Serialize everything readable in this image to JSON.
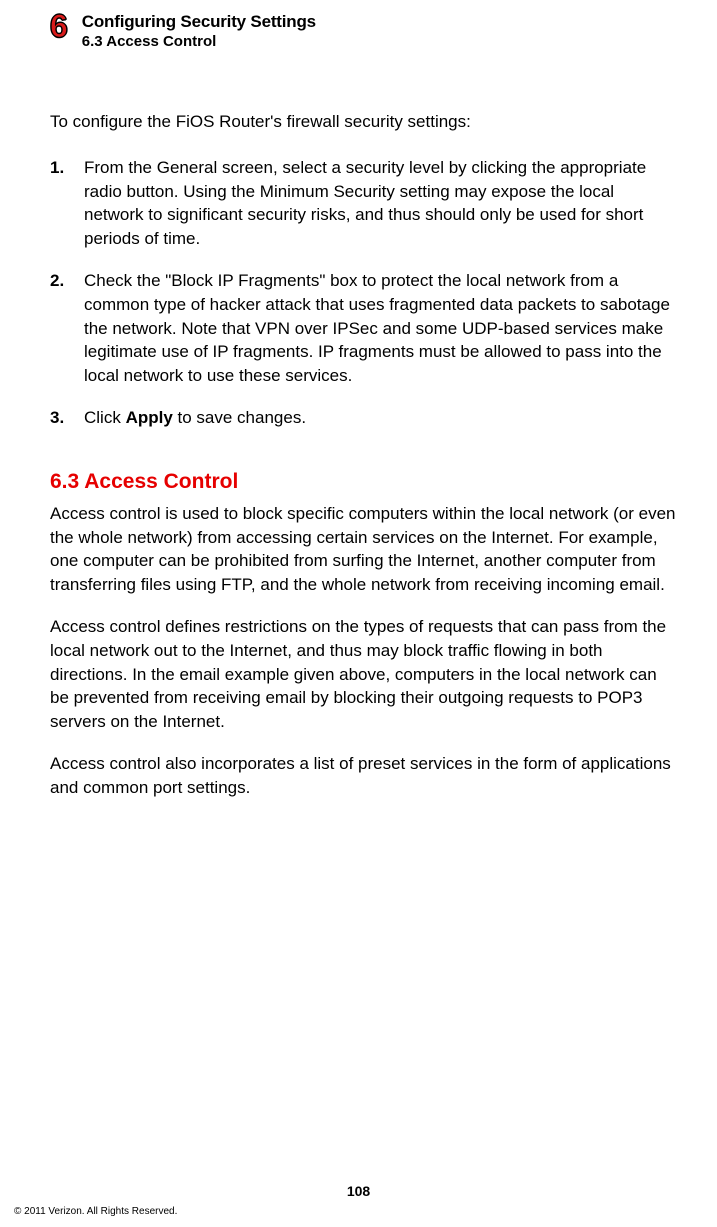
{
  "header": {
    "chapter_number": "6",
    "chapter_title": "Configuring Security Settings",
    "section_sub": "6.3  Access Control"
  },
  "intro": "To configure the FiOS Router's firewall security settings:",
  "steps": [
    {
      "num": "1.",
      "text": "From the General screen, select a security level by clicking the appropriate radio button. Using the Minimum Security setting may expose the local network to significant security risks, and thus should only be used for short periods of time."
    },
    {
      "num": "2.",
      "text": "Check the \"Block IP Fragments\" box to protect the local network from a common type of hacker attack that uses fragmented data packets to sabotage the network. Note that VPN over IPSec and some UDP-based services make legitimate use of IP fragments. IP fragments must be allowed to pass into the local network to use these services."
    },
    {
      "num": "3.",
      "text_prefix": "Click ",
      "text_bold": "Apply",
      "text_suffix": " to save changes."
    }
  ],
  "section": {
    "heading": "6.3  Access Control",
    "p1": "Access control is used to block specific computers within the local network (or even the whole network) from accessing certain services on the Internet. For example, one computer can be prohibited from surfing the Internet, another computer from transferring files using FTP, and the whole network from receiving incoming email.",
    "p2": "Access control defines restrictions on the types of requests that can pass from the local network out to the Internet, and thus may block traffic flowing in both directions. In the email example given above, computers in the local network can be prevented from receiving email by blocking their outgoing requests to POP3 servers on the Internet.",
    "p3": "Access control also incorporates a list of preset services in the form of applications and common port settings."
  },
  "footer": {
    "page_number": "108",
    "copyright": "© 2011 Verizon. All Rights Reserved."
  }
}
